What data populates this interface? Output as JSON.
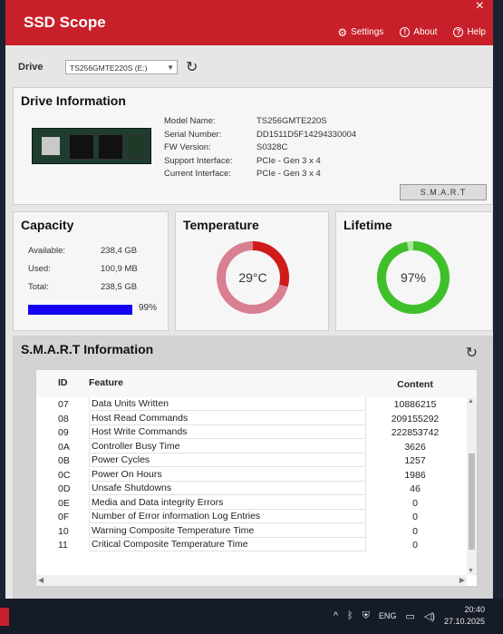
{
  "app": {
    "title": "SSD Scope",
    "close_glyph": "×"
  },
  "nav": {
    "settings": "Settings",
    "about": "About",
    "help": "Help"
  },
  "drive": {
    "label": "Drive",
    "selected": "TS256GMTE220S (E:)"
  },
  "drive_info": {
    "title": "Drive Information",
    "fields": [
      {
        "key": "Model Name:",
        "value": "TS256GMTE220S"
      },
      {
        "key": "Serial Number:",
        "value": "DD1511D5F14294330004"
      },
      {
        "key": "FW Version:",
        "value": "S0328C"
      },
      {
        "key": "Support Interface:",
        "value": "PCIe - Gen 3 x 4"
      },
      {
        "key": "Current Interface:",
        "value": "PCIe - Gen 3 x 4"
      }
    ],
    "smart_button": "S.M.A.R.T"
  },
  "capacity": {
    "title": "Capacity",
    "available_label": "Available:",
    "available_value": "238,4 GB",
    "used_label": "Used:",
    "used_value": "100,9 MB",
    "total_label": "Total:",
    "total_value": "238,5 GB",
    "bar_percent_text": "99%",
    "bar_fill_fraction": 0.99,
    "bar_color": "#1400f0"
  },
  "temperature": {
    "title": "Temperature",
    "value_text": "29°C",
    "gauge_fraction": 0.29,
    "arc_color": "#d11b1b",
    "track_color": "#d97f92"
  },
  "lifetime": {
    "title": "Lifetime",
    "value_text": "97%",
    "gauge_fraction": 0.97,
    "arc_color": "#3fbf2a",
    "track_color": "#a9e39b"
  },
  "smart": {
    "title": "S.M.A.R.T Information",
    "headers": {
      "id": "ID",
      "feature": "Feature",
      "content": "Content"
    },
    "rows": [
      {
        "id": "07",
        "feature": "Data Units Written",
        "content": "10886215"
      },
      {
        "id": "08",
        "feature": "Host Read Commands",
        "content": "209155292"
      },
      {
        "id": "09",
        "feature": "Host Write Commands",
        "content": "222853742"
      },
      {
        "id": "0A",
        "feature": "Controller Busy Time",
        "content": "3626"
      },
      {
        "id": "0B",
        "feature": "Power Cycles",
        "content": "1257"
      },
      {
        "id": "0C",
        "feature": "Power On Hours",
        "content": "1986"
      },
      {
        "id": "0D",
        "feature": "Unsafe Shutdowns",
        "content": "46"
      },
      {
        "id": "0E",
        "feature": "Media and Data integrity Errors",
        "content": "0"
      },
      {
        "id": "0F",
        "feature": "Number of Error information Log Entries",
        "content": "0"
      },
      {
        "id": "10",
        "feature": "Warning Composite Temperature Time",
        "content": "0"
      },
      {
        "id": "11",
        "feature": "Critical Composite Temperature Time",
        "content": "0"
      }
    ]
  },
  "taskbar": {
    "language": "ENG",
    "time": "20:40",
    "date": "27.10.2025"
  },
  "colors": {
    "brand": "#c8202a"
  }
}
